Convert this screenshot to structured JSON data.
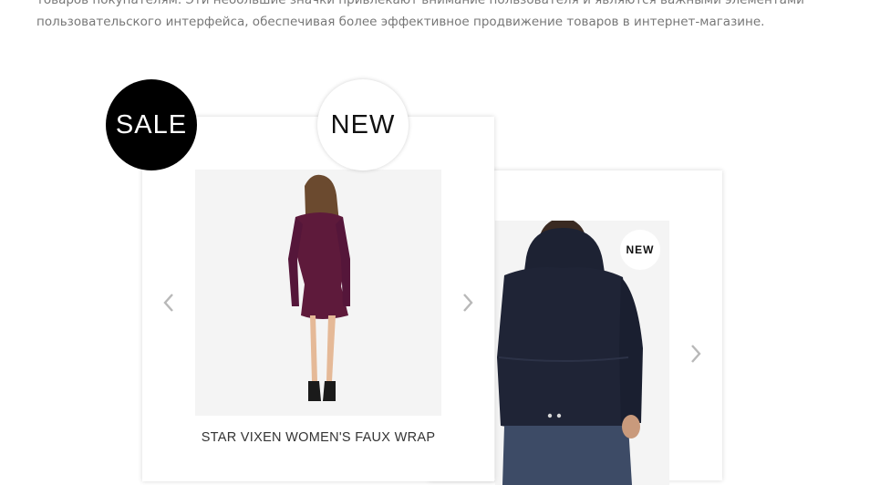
{
  "intro": {
    "line1": "товаров покупателям. Эти небольшие значки привлекают внимание пользователя и являются важными элементами",
    "line2": "пользовательского интерфейса, обеспечивая более эффективное продвижение товаров в интернет-магазине."
  },
  "badges": {
    "sale": "SALE",
    "new_large": "NEW",
    "new_small": "NEW"
  },
  "products": [
    {
      "title": "STAR VIXEN WOMEN'S FAUX WRAP",
      "price": ""
    },
    {
      "title": "",
      "price": ""
    }
  ],
  "colors": {
    "badge_dark": "#000000",
    "image_bg": "#f4f4f4",
    "arrow": "#b8b8b8"
  },
  "icons": {
    "prev": "chevron-left-icon",
    "next": "chevron-right-icon"
  }
}
